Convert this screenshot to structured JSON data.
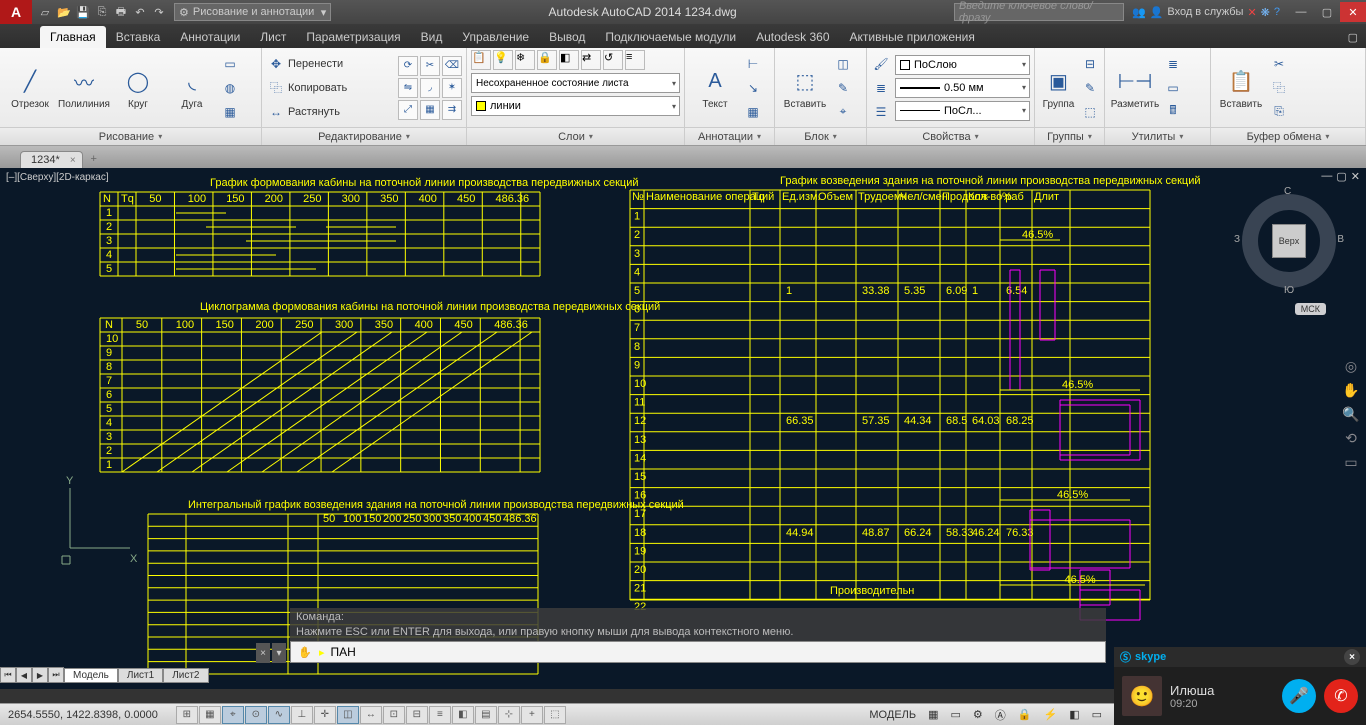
{
  "title": "Autodesk AutoCAD 2014   1234.dwg",
  "workspace": "Рисование и аннотации",
  "search_placeholder": "Введите ключевое слово/фразу",
  "signin": "Вход в службы",
  "ribbon_tabs": [
    "Главная",
    "Вставка",
    "Аннотации",
    "Лист",
    "Параметризация",
    "Вид",
    "Управление",
    "Вывод",
    "Подключаемые модули",
    "Autodesk 360",
    "Активные приложения"
  ],
  "active_tab": 0,
  "panels": {
    "draw": {
      "title": "Рисование",
      "line": "Отрезок",
      "pline": "Полилиния",
      "circle": "Круг",
      "arc": "Дуга"
    },
    "modify": {
      "title": "Редактирование",
      "move": "Перенести",
      "copy": "Копировать",
      "stretch": "Растянуть"
    },
    "layers": {
      "title": "Слои",
      "state": "Несохраненное состояние листа",
      "current": "линии"
    },
    "annot": {
      "title": "Аннотации",
      "text": "Текст"
    },
    "block": {
      "title": "Блок",
      "insert": "Вставить"
    },
    "props": {
      "title": "Свойства",
      "color": "ПоСлою",
      "lw": "0.50 мм",
      "lt": "ПоСл..."
    },
    "groups": {
      "title": "Группы",
      "group": "Группа"
    },
    "utils": {
      "title": "Утилиты",
      "measure": "Разметить"
    },
    "clip": {
      "title": "Буфер обмена",
      "paste": "Вставить"
    }
  },
  "file_tab": "1234*",
  "view_label": "[–][Сверху][2D-каркас]",
  "viewcube": {
    "face": "Верх",
    "n": "С",
    "s": "Ю",
    "e": "В",
    "w": "З"
  },
  "msk": "МСК",
  "cmd_history": [
    "Команда:",
    "Нажмите ESC или ENTER для выхода, или правую кнопку мыши для вывода контекстного меню."
  ],
  "cmd_value": "ПАН",
  "layout_tabs": [
    "Модель",
    "Лист1",
    "Лист2"
  ],
  "coords": "2654.5550, 1422.8398, 0.0000",
  "status_right": {
    "model": "МОДЕЛЬ"
  },
  "skype": {
    "brand": "skype",
    "name": "Илюша",
    "time": "09:20"
  },
  "drawing": {
    "t1": {
      "title": "График формования кабины на поточной линии производства передвижных секций",
      "cols": [
        "N",
        "Tq",
        "50",
        "100",
        "150",
        "200",
        "250",
        "300",
        "350",
        "400",
        "450",
        "486.36"
      ],
      "rows": [
        1,
        2,
        3,
        4,
        5
      ]
    },
    "t2": {
      "title": "Циклограмма формования кабины на поточной линии производства передвижных секций",
      "cols": [
        "N",
        "50",
        "100",
        "150",
        "200",
        "250",
        "300",
        "350",
        "400",
        "450",
        "486.36"
      ],
      "rows": [
        10,
        9,
        8,
        7,
        6,
        5,
        4,
        3,
        2,
        1
      ]
    },
    "t3": {
      "title": "Интегральный график возведения здания на поточной линии производства передвижных секций",
      "col_ticks": [
        "50",
        "100",
        "150",
        "200",
        "250",
        "300",
        "350",
        "400",
        "450",
        "486.36"
      ]
    },
    "t4": {
      "title": "График возведения здания на поточной линии производства передвижных секций",
      "headers": [
        "№",
        "Наименование операций",
        "Tq",
        "Ед.изм.",
        "Объем",
        "Трудоемк",
        "Чел/смен",
        "Продолж",
        "Кол-во раб",
        "%",
        "Длит"
      ],
      "footer": "Производительн",
      "sample_vals": [
        "1",
        "33.38",
        "5.35",
        "6.09",
        "1",
        "6.54",
        "66.35",
        "57.35",
        "44.34",
        "68.5",
        "64.03",
        "68.25",
        "44.94",
        "48.87",
        "66.24",
        "58.33",
        "46.24",
        "76.33"
      ]
    }
  }
}
